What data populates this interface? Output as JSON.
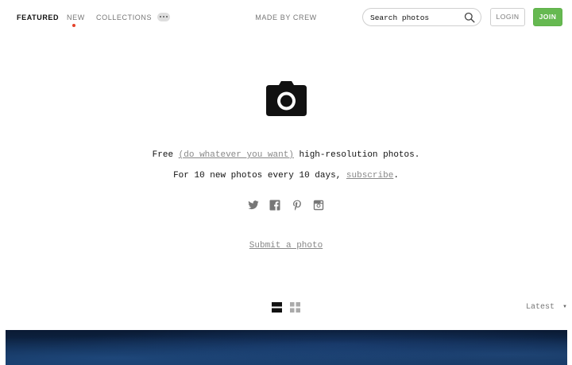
{
  "nav": {
    "featured": "FEATURED",
    "new": "NEW",
    "collections": "COLLECTIONS",
    "made_by": "MADE BY CREW"
  },
  "search": {
    "placeholder": "Search photos"
  },
  "buttons": {
    "login": "LOGIN",
    "join": "JOIN"
  },
  "hero": {
    "line1_pre": "Free ",
    "line1_link": "(do whatever you want)",
    "line1_post": " high-resolution photos.",
    "line2_pre": "For 10 new photos every 10 days, ",
    "line2_link": "subscribe",
    "line2_post": ".",
    "submit": "Submit a photo"
  },
  "social_icons": [
    "twitter-icon",
    "facebook-icon",
    "pinterest-icon",
    "instagram-icon"
  ],
  "view": {
    "sort_label": "Latest",
    "caret": "▼"
  },
  "colors": {
    "accent_green": "#66b951",
    "new_dot": "#e4422a",
    "link_gray": "#888888"
  }
}
